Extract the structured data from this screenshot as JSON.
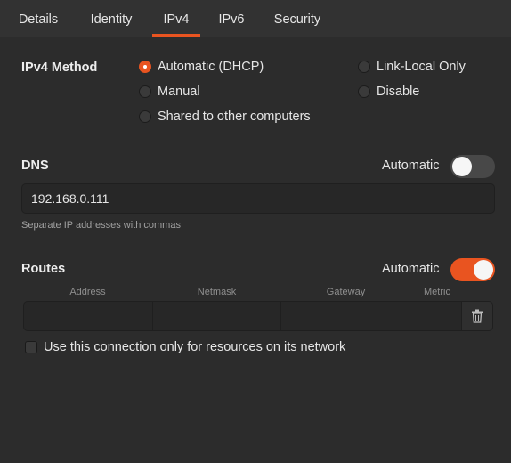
{
  "tabs": [
    {
      "label": "Details"
    },
    {
      "label": "Identity"
    },
    {
      "label": "IPv4"
    },
    {
      "label": "IPv6"
    },
    {
      "label": "Security"
    }
  ],
  "active_tab": "IPv4",
  "ipv4_method": {
    "title": "IPv4 Method",
    "options": {
      "automatic": {
        "label": "Automatic (DHCP)",
        "selected": true
      },
      "manual": {
        "label": "Manual",
        "selected": false
      },
      "shared": {
        "label": "Shared to other computers",
        "selected": false
      },
      "link_local": {
        "label": "Link-Local Only",
        "selected": false
      },
      "disable": {
        "label": "Disable",
        "selected": false
      }
    }
  },
  "dns": {
    "title": "DNS",
    "automatic_label": "Automatic",
    "automatic_on": false,
    "value": "192.168.0.111",
    "hint": "Separate IP addresses with commas"
  },
  "routes": {
    "title": "Routes",
    "automatic_label": "Automatic",
    "automatic_on": true,
    "columns": {
      "address": "Address",
      "netmask": "Netmask",
      "gateway": "Gateway",
      "metric": "Metric"
    }
  },
  "only_local": {
    "label": "Use this connection only for resources on its network",
    "checked": false
  },
  "colors": {
    "accent": "#e95420",
    "background": "#2c2c2c",
    "entry": "#272727"
  },
  "icons": {
    "delete": "trash-icon"
  }
}
